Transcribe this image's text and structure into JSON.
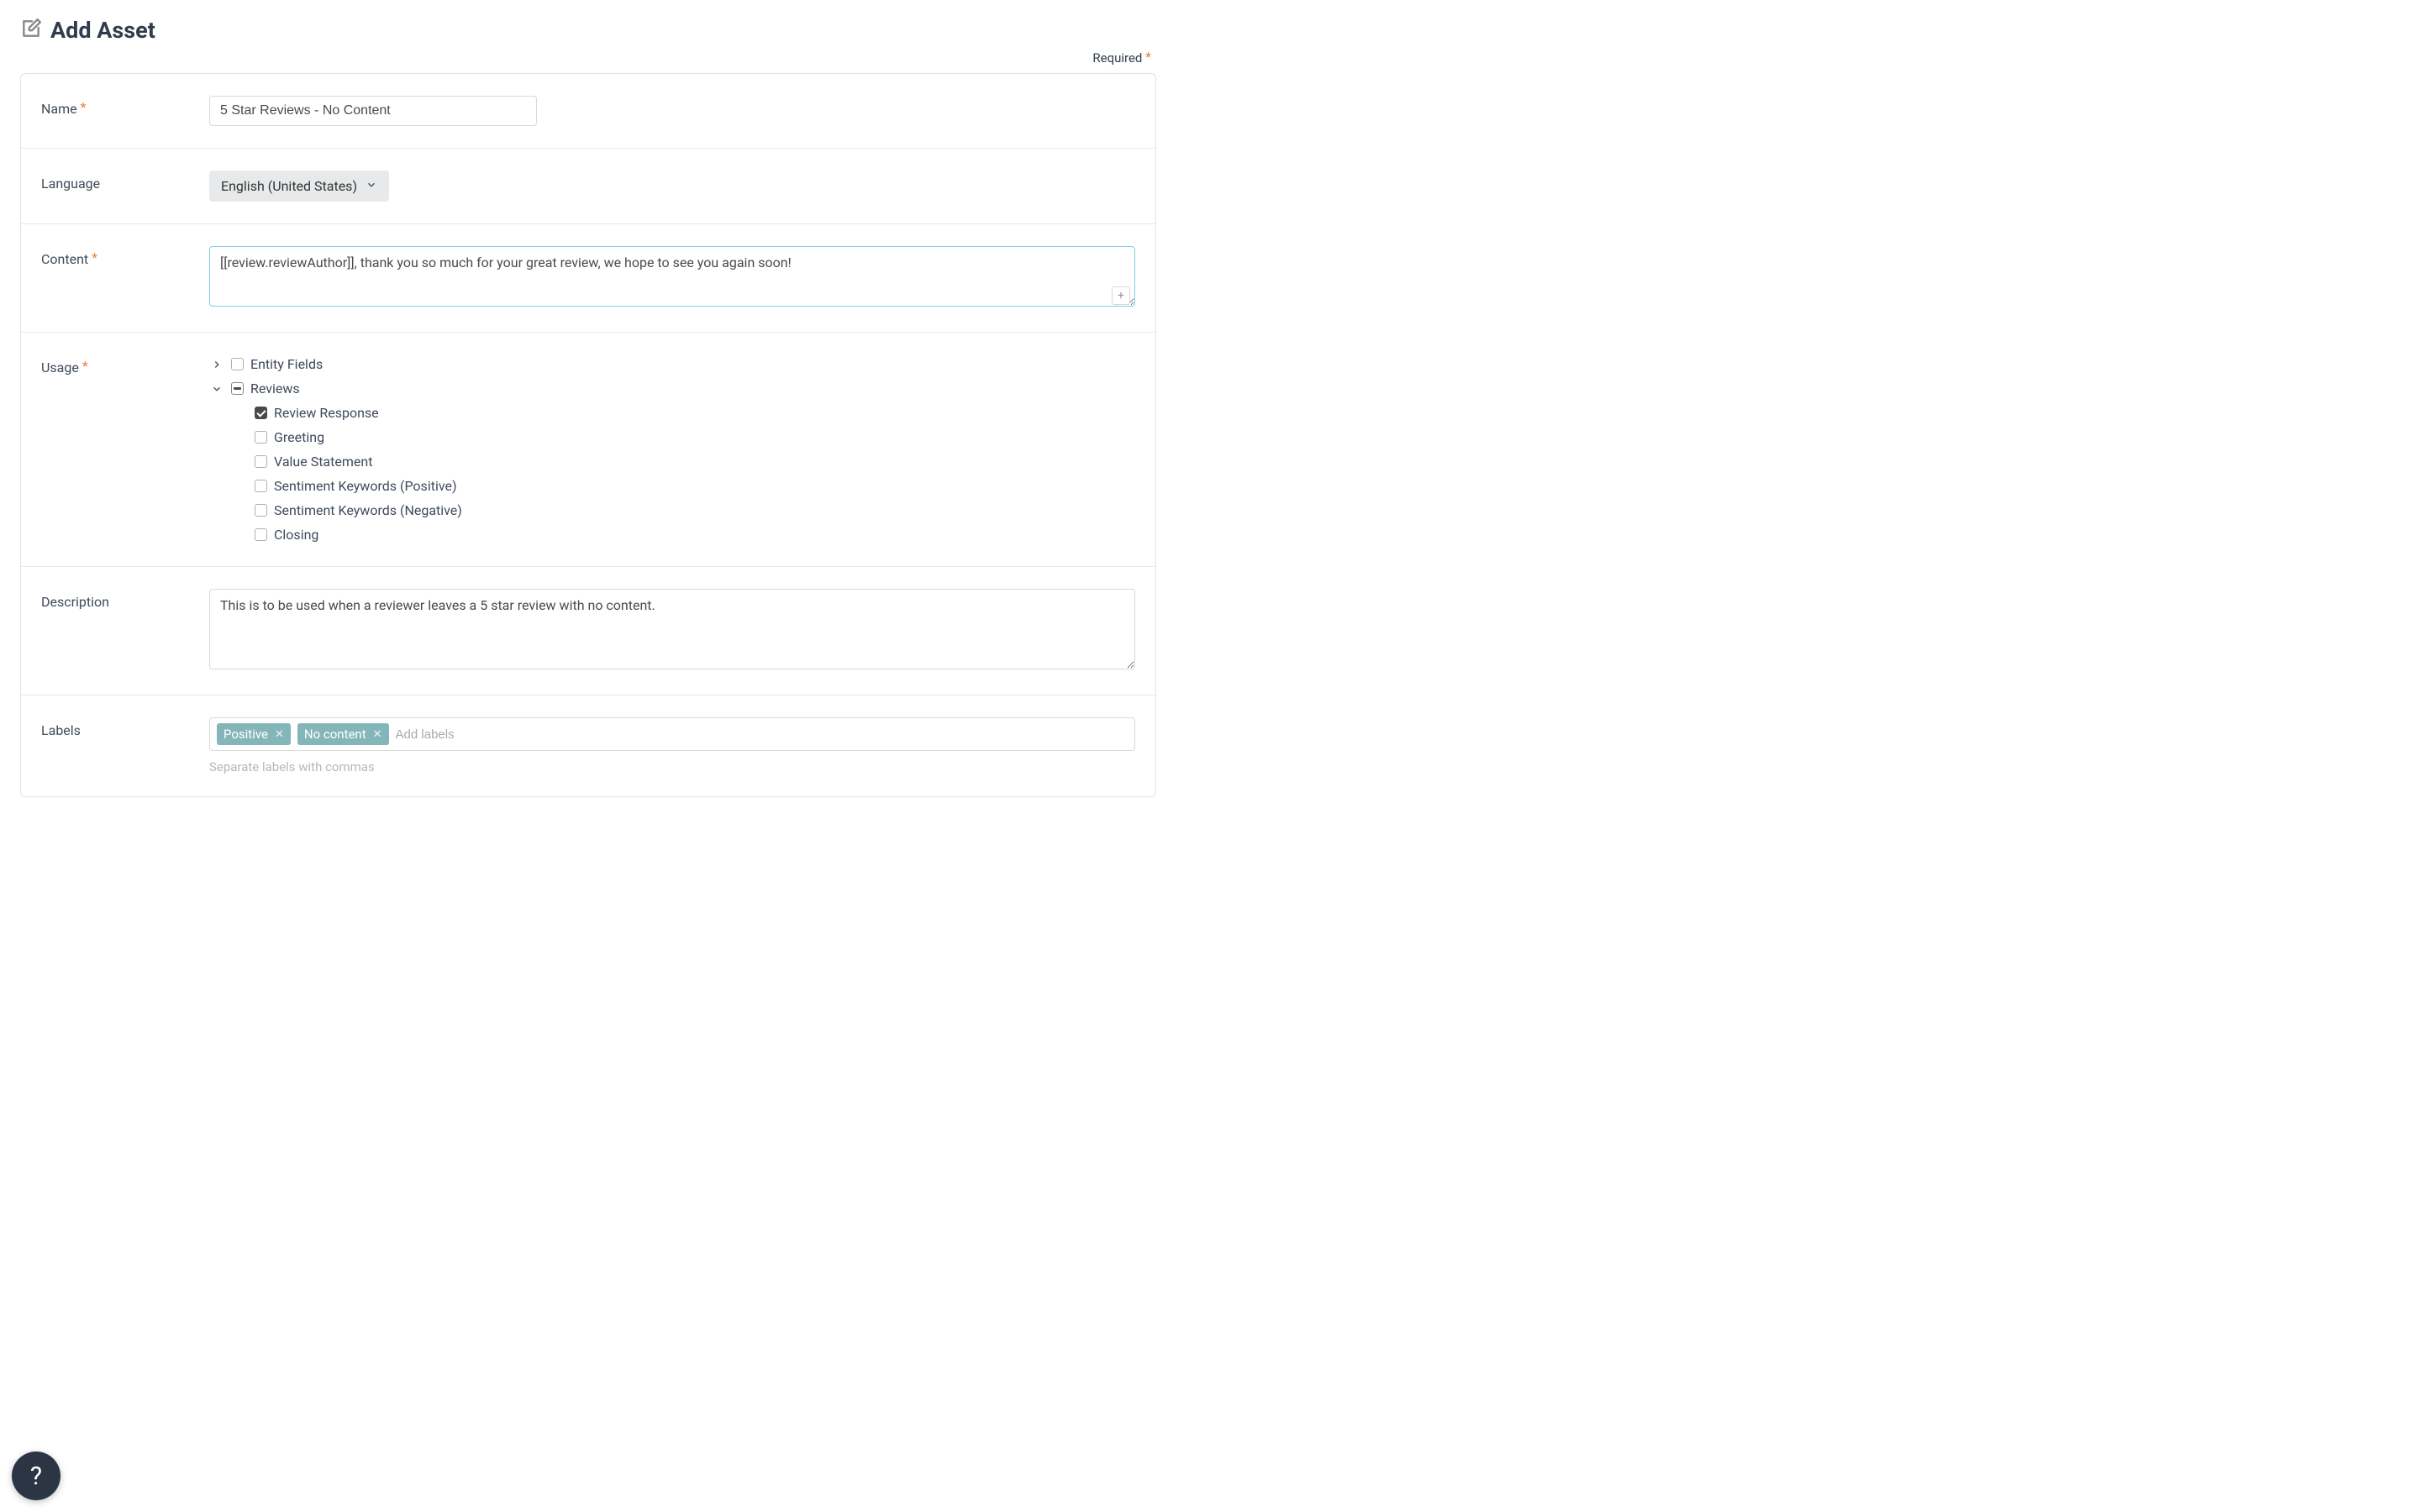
{
  "header": {
    "title": "Add Asset",
    "requiredLabel": "Required"
  },
  "fields": {
    "name": {
      "label": "Name",
      "value": "5 Star Reviews - No Content"
    },
    "language": {
      "label": "Language",
      "value": "English (United States)"
    },
    "content": {
      "label": "Content",
      "value": "[[review.reviewAuthor]], thank you so much for your great review, we hope to see you again soon!"
    },
    "usage": {
      "label": "Usage",
      "tree": {
        "entityFields": {
          "label": "Entity Fields",
          "expanded": false,
          "checked": false
        },
        "reviews": {
          "label": "Reviews",
          "expanded": true,
          "indeterminate": true,
          "children": [
            {
              "key": "review-response",
              "label": "Review Response",
              "checked": true
            },
            {
              "key": "greeting",
              "label": "Greeting",
              "checked": false
            },
            {
              "key": "value-statement",
              "label": "Value Statement",
              "checked": false
            },
            {
              "key": "sentiment-positive",
              "label": "Sentiment Keywords (Positive)",
              "checked": false
            },
            {
              "key": "sentiment-negative",
              "label": "Sentiment Keywords (Negative)",
              "checked": false
            },
            {
              "key": "closing",
              "label": "Closing",
              "checked": false
            }
          ]
        }
      }
    },
    "description": {
      "label": "Description",
      "value": "This is to be used when a reviewer leaves a 5 star review with no content."
    },
    "labels": {
      "label": "Labels",
      "tags": [
        "Positive",
        "No content"
      ],
      "placeholder": "Add labels",
      "hint": "Separate labels with commas"
    }
  },
  "plusIcon": "+"
}
